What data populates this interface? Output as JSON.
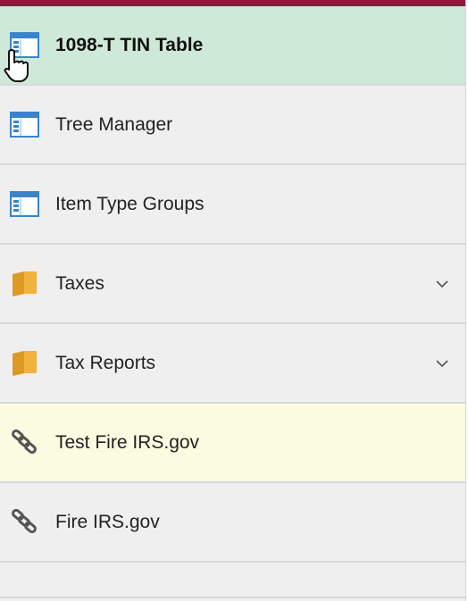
{
  "menu": {
    "items": [
      {
        "label": "1098-T TIN Table",
        "icon": "component-page-icon",
        "state": "active"
      },
      {
        "label": "Tree Manager",
        "icon": "component-page-icon"
      },
      {
        "label": "Item Type Groups",
        "icon": "component-page-icon"
      },
      {
        "label": "Taxes",
        "icon": "folder-icon",
        "expandable": true
      },
      {
        "label": "Tax Reports",
        "icon": "folder-icon",
        "expandable": true
      },
      {
        "label": "Test Fire IRS.gov",
        "icon": "link-icon",
        "state": "highlight"
      },
      {
        "label": "Fire IRS.gov",
        "icon": "link-icon"
      }
    ]
  },
  "colors": {
    "topbar": "#8b1a3a",
    "active_bg": "#cfe9d8",
    "highlight_bg": "#fbfbe2",
    "item_bg": "#efefef"
  }
}
